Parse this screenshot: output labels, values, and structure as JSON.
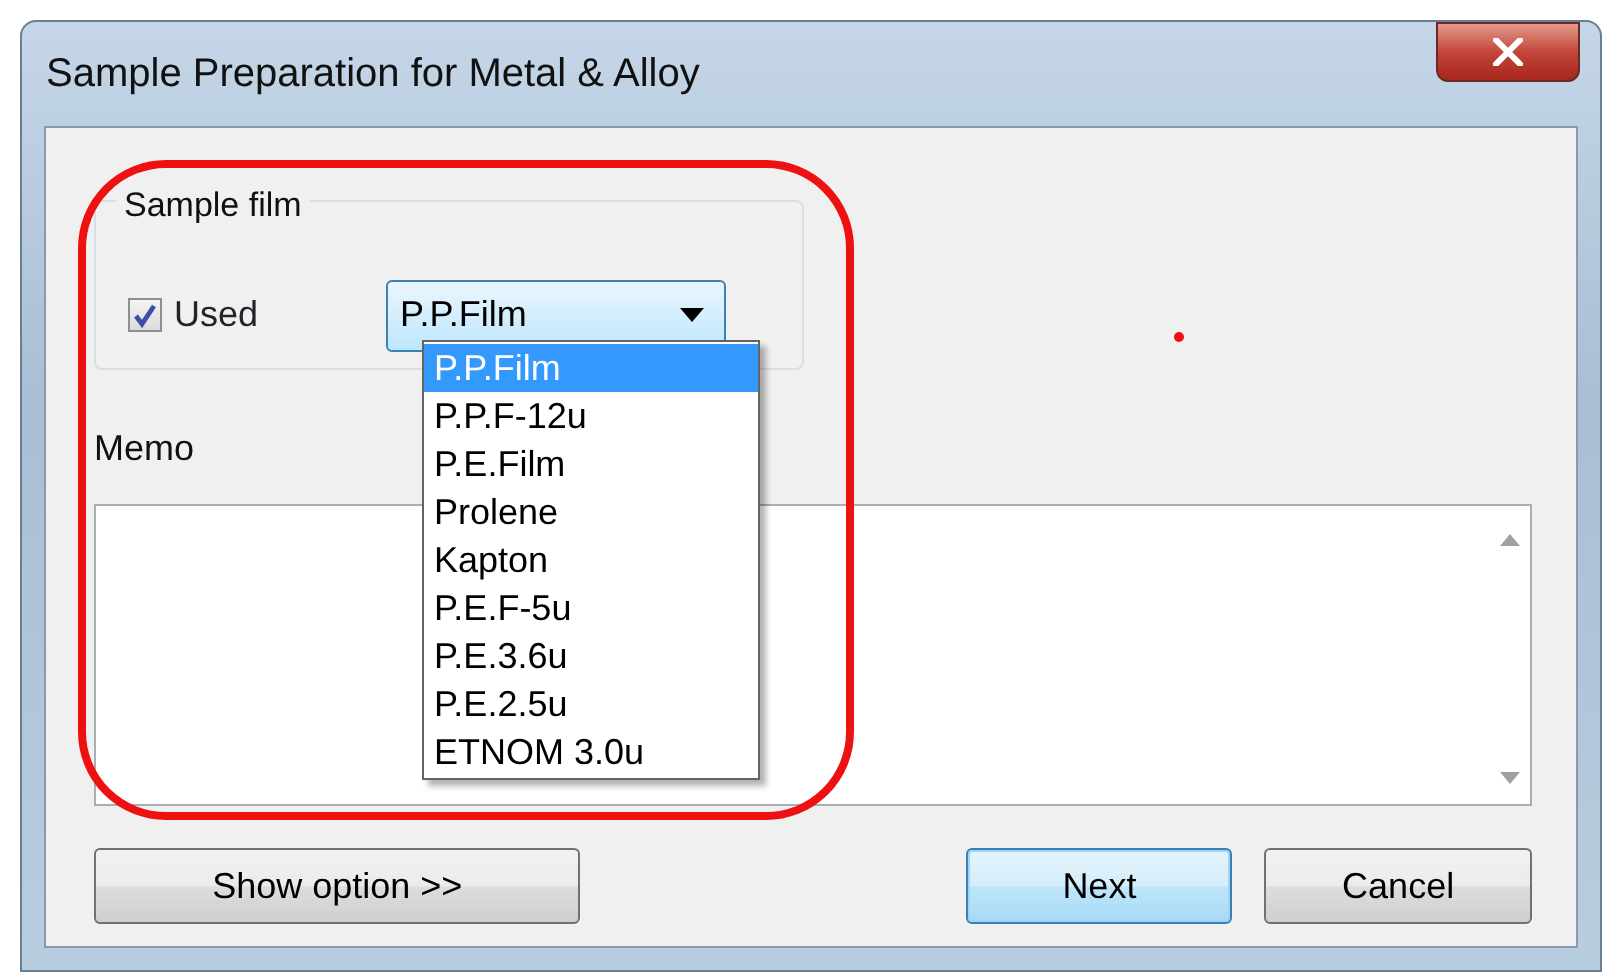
{
  "window": {
    "title": "Sample Preparation for Metal & Alloy"
  },
  "sample_film": {
    "legend": "Sample film",
    "used": {
      "label": "Used",
      "checked": true
    },
    "film": {
      "value": "P.P.Film",
      "expanded": true,
      "options": [
        {
          "label": "P.P.Film",
          "selected": true
        },
        {
          "label": "P.P.F-12u",
          "selected": false
        },
        {
          "label": "P.E.Film",
          "selected": false
        },
        {
          "label": "Prolene",
          "selected": false
        },
        {
          "label": "Kapton",
          "selected": false
        },
        {
          "label": "P.E.F-5u",
          "selected": false
        },
        {
          "label": "P.E.3.6u",
          "selected": false
        },
        {
          "label": "P.E.2.5u",
          "selected": false
        },
        {
          "label": "ETNOM 3.0u",
          "selected": false
        }
      ]
    }
  },
  "memo": {
    "label": "Memo"
  },
  "buttons": [
    {
      "label": "Show option >>",
      "default": false
    },
    {
      "label": "Next",
      "default": true
    },
    {
      "label": "Cancel",
      "default": false
    }
  ]
}
